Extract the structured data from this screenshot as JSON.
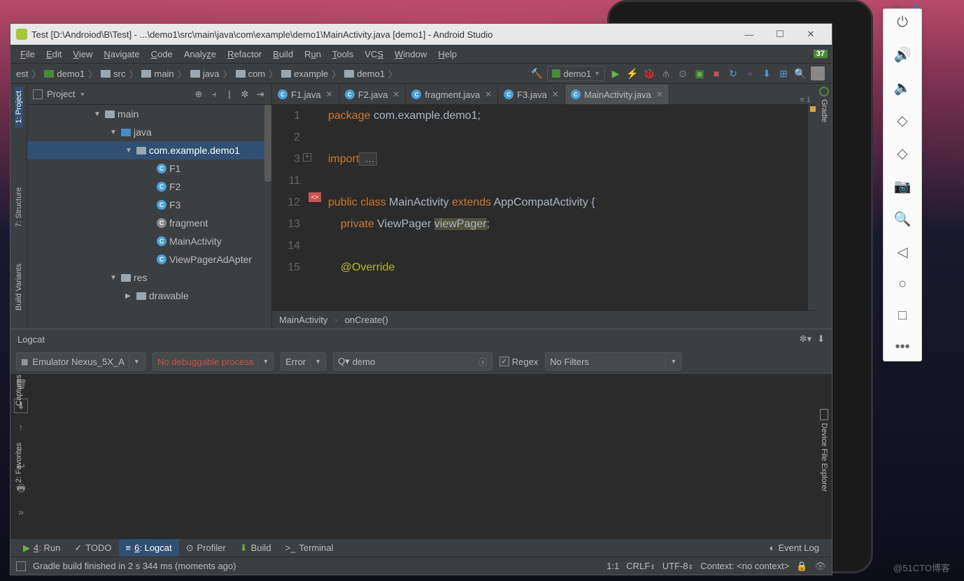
{
  "window": {
    "title": "Test [D:\\Androiod\\B\\Test] - ...\\demo1\\src\\main\\java\\com\\example\\demo1\\MainActivity.java [demo1] - Android Studio"
  },
  "menu": [
    "File",
    "Edit",
    "View",
    "Navigate",
    "Code",
    "Analyze",
    "Refactor",
    "Build",
    "Run",
    "Tools",
    "VCS",
    "Window",
    "Help"
  ],
  "menu_underline": [
    0,
    0,
    0,
    0,
    0,
    -1,
    0,
    0,
    0,
    0,
    2,
    0,
    0
  ],
  "version_badge": "37",
  "breadcrumb": [
    "est",
    "demo1",
    "src",
    "main",
    "java",
    "com",
    "example",
    "demo1"
  ],
  "run_config": "demo1",
  "left_tools": [
    "1: Project",
    "7: Structure",
    "Build Variants",
    "Captures",
    "2: Favorites"
  ],
  "project_panel": {
    "title": "Project",
    "tree": {
      "main": "main",
      "java": "java",
      "pkg": "com.example.demo1",
      "files": [
        "F1",
        "F2",
        "F3",
        "fragment",
        "MainActivity",
        "ViewPagerAdApter"
      ],
      "res": "res",
      "drawable": "drawable"
    }
  },
  "tabs": [
    "F1.java",
    "F2.java",
    "fragment.java",
    "F3.java",
    "MainActivity.java"
  ],
  "active_tab": 4,
  "tab_right": "≡ 1",
  "code": {
    "line_nums": [
      "1",
      "2",
      "3",
      "11",
      "12",
      "13",
      "14",
      "15"
    ],
    "pkg_kw": "package",
    "pkg_name": " com.example.demo1;",
    "import_kw": "import",
    "import_rest": " ...",
    "public": "public",
    "class": " class",
    "clsname": " MainActivity ",
    "extends": "extends",
    "parent": " AppCompatActivity {",
    "private": "private",
    "vp_type": " ViewPager ",
    "vp_name": "viewPager",
    "semi": ";",
    "override": "@Override"
  },
  "crumb_nav": [
    "MainActivity",
    "onCreate()"
  ],
  "right_tools": [
    "Gradle",
    "Device File Explorer"
  ],
  "logcat": {
    "title": "Logcat",
    "device": "Emulator Nexus_5X_A",
    "process": "No debuggable process",
    "level": "Error",
    "search": "demo",
    "regex": "Regex",
    "filter": "No Filters"
  },
  "bottom_tools": [
    "4: Run",
    "TODO",
    "6: Logcat",
    "Profiler",
    "Build",
    "Terminal"
  ],
  "event_log": "Event Log",
  "status": {
    "msg": "Gradle build finished in 2 s 344 ms (moments ago)",
    "pos": "1:1",
    "enc1": "CRLF",
    "enc2": "UTF-8",
    "ctx": "Context: <no context>"
  },
  "watermark": "@51CTO博客"
}
